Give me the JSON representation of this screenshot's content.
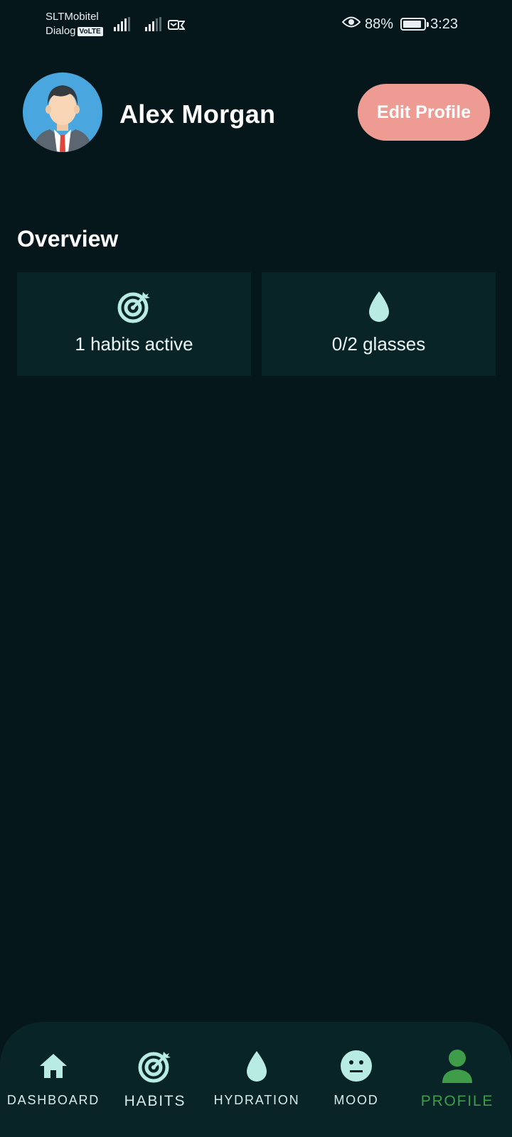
{
  "status_bar": {
    "carrier_1": "SLTMobitel",
    "carrier_2": "Dialog",
    "volte_badge": "VoLTE",
    "battery_percent": "88%",
    "battery_level": 0.88,
    "time": "3:23"
  },
  "profile": {
    "name": "Alex Morgan",
    "edit_button_label": "Edit Profile"
  },
  "overview": {
    "title": "Overview",
    "cards": [
      {
        "icon": "target-icon",
        "text": "1 habits active"
      },
      {
        "icon": "water-drop-icon",
        "text": "0/2 glasses"
      }
    ]
  },
  "bottom_nav": {
    "items": [
      {
        "icon": "home-icon",
        "label": "DASHBOARD"
      },
      {
        "icon": "target-icon",
        "label": "HABITS"
      },
      {
        "icon": "water-drop-icon",
        "label": "HYDRATION"
      },
      {
        "icon": "neutral-face-icon",
        "label": "MOOD"
      },
      {
        "icon": "person-icon",
        "label": "PROFILE"
      }
    ],
    "active": "PROFILE"
  },
  "colors": {
    "background": "#05171b",
    "card": "#082427",
    "accent_button": "#ee9b94",
    "icon_mint": "#b8ece2",
    "active_nav": "#3f9d4a"
  }
}
